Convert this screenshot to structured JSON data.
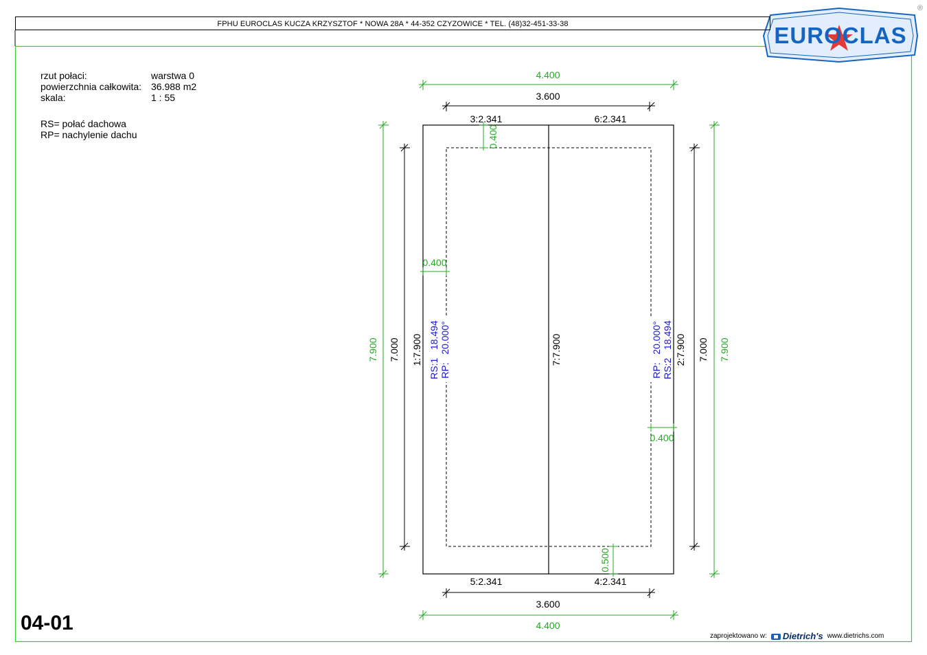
{
  "header": {
    "company_line": "FPHU EUROCLAS KUCZA KRZYSZTOF * NOWA 28A * 44-352 CZYZOWICE * TEL. (48)32-451-33-38",
    "logo_text": "EUROCLAS",
    "registered_mark": "®"
  },
  "info": {
    "rows": [
      {
        "label": "rzut połaci:",
        "value": "warstwa 0"
      },
      {
        "label": "powierzchnia całkowita:",
        "value": "36.988 m2"
      },
      {
        "label": "skala:",
        "value": "1 : 55"
      }
    ],
    "legend": [
      "RS= połać dachowa",
      "RP= nachylenie dachu"
    ]
  },
  "drawing": {
    "dims": {
      "top_outer": "4.400",
      "top_inner": "3.600",
      "bottom_inner": "3.600",
      "bottom_outer": "4.400",
      "left_outer": "7.900",
      "left_inner": "7.000",
      "right_outer": "7.900",
      "right_inner": "7.000",
      "offset_top": "0.400",
      "offset_left": "0.400",
      "offset_right": "0.400",
      "offset_bottom": "0.500"
    },
    "edges": {
      "top_left": "3:2.341",
      "top_right": "6:2.341",
      "bottom_left": "5:2.341",
      "bottom_right": "4:2.341",
      "left": "1:7.900",
      "middle": "7:7.900",
      "right": "2:7.900"
    },
    "slopes": {
      "left_rs": "RS:1   18.494",
      "left_rp": "RP:   20.000°",
      "right_rp": "RP:   20.000°",
      "right_rs": "RS:2   18.494"
    }
  },
  "footer": {
    "sheet_number": "04-01",
    "designed_with": "zaprojektowano w:",
    "brand": "Dietrich's",
    "website": "www.dietrichs.com"
  },
  "colors": {
    "dimension": "#22aa22",
    "slope_text": "#1a1acc",
    "frame": "#33cc33",
    "logo_blue": "#1565c0",
    "logo_star": "#e53935"
  }
}
